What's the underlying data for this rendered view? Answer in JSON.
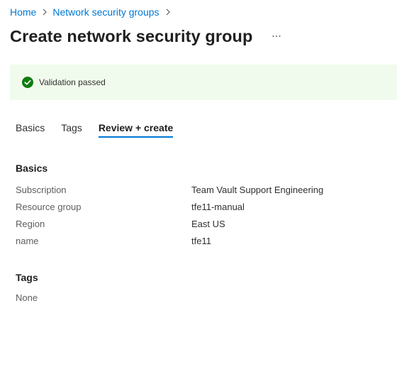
{
  "breadcrumb": {
    "items": [
      {
        "label": "Home"
      },
      {
        "label": "Network security groups"
      }
    ]
  },
  "page": {
    "title": "Create network security group"
  },
  "banner": {
    "status": "success",
    "text": "Validation passed",
    "color": "#107c10"
  },
  "tabs": {
    "items": [
      {
        "label": "Basics",
        "active": false
      },
      {
        "label": "Tags",
        "active": false
      },
      {
        "label": "Review + create",
        "active": true
      }
    ]
  },
  "summary": {
    "basics": {
      "heading": "Basics",
      "rows": [
        {
          "key": "Subscription",
          "value": "Team Vault Support Engineering"
        },
        {
          "key": "Resource group",
          "value": "tfe11-manual"
        },
        {
          "key": "Region",
          "value": "East US"
        },
        {
          "key": "name",
          "value": "tfe11"
        }
      ]
    },
    "tags": {
      "heading": "Tags",
      "value": "None"
    }
  },
  "colors": {
    "link": "#0078d4",
    "banner_bg": "#f1fbed",
    "accent": "#0078d4"
  }
}
